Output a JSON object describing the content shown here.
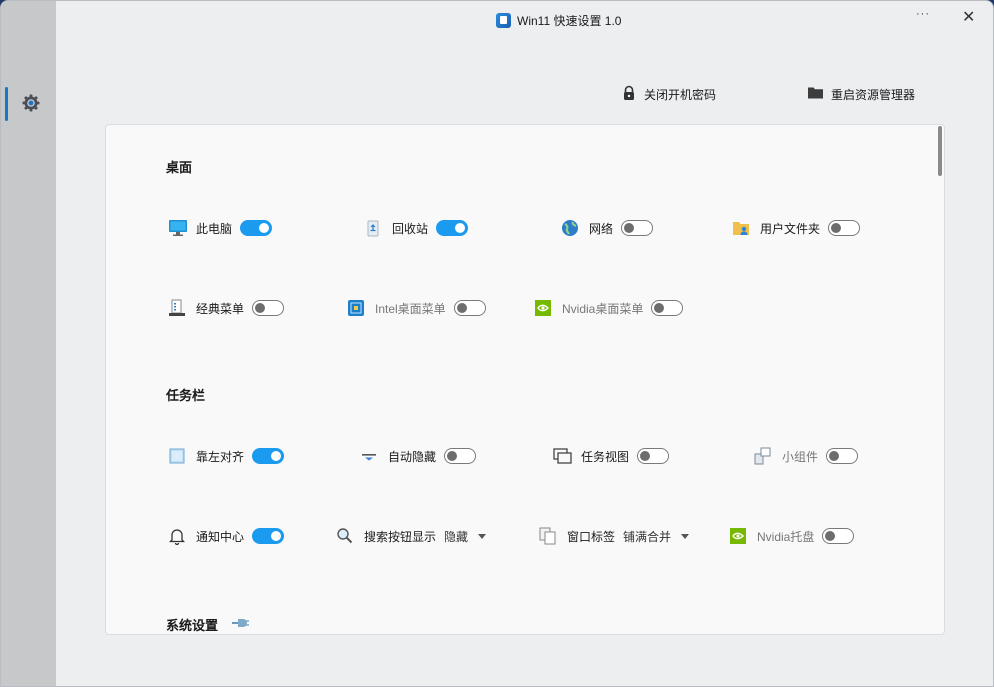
{
  "window": {
    "title": "Win11 快速设置 1.0",
    "more_label": "···",
    "close_label": "✕"
  },
  "sidebar": {
    "items": [
      {
        "icon": "gear-icon",
        "active": true
      }
    ]
  },
  "actions": {
    "lock_label": "关闭开机密码",
    "explorer_label": "重启资源管理器"
  },
  "sections": {
    "desktop": {
      "title": "桌面",
      "items": [
        {
          "label": "此电脑",
          "icon": "monitor-icon",
          "on": true
        },
        {
          "label": "回收站",
          "icon": "recycle-bin-icon",
          "on": true
        },
        {
          "label": "网络",
          "icon": "globe-icon",
          "on": false
        },
        {
          "label": "用户文件夹",
          "icon": "user-folder-icon",
          "on": false
        },
        {
          "label": "经典菜单",
          "icon": "classic-menu-icon",
          "on": false
        },
        {
          "label": "Intel桌面菜单",
          "icon": "intel-icon",
          "on": false,
          "disabled": true
        },
        {
          "label": "Nvidia桌面菜单",
          "icon": "nvidia-icon",
          "on": false,
          "disabled": true
        }
      ]
    },
    "taskbar": {
      "title": "任务栏",
      "items": [
        {
          "label": "靠左对齐",
          "icon": "align-left-icon",
          "on": true
        },
        {
          "label": "自动隐藏",
          "icon": "auto-hide-icon",
          "on": false
        },
        {
          "label": "任务视图",
          "icon": "task-view-icon",
          "on": false
        },
        {
          "label": "小组件",
          "icon": "widgets-icon",
          "on": false,
          "disabled": true
        },
        {
          "label": "通知中心",
          "icon": "bell-icon",
          "on": true
        },
        {
          "label": "搜索按钮显示",
          "icon": "search-icon",
          "dropdown": "隐藏"
        },
        {
          "label": "窗口标签",
          "icon": "window-tabs-icon",
          "dropdown": "铺满合并"
        },
        {
          "label": "Nvidia托盘",
          "icon": "nvidia-icon",
          "on": false,
          "disabled": true
        }
      ]
    },
    "system": {
      "title": "系统设置"
    }
  },
  "colors": {
    "accent": "#1a9bf0",
    "sidebar": "#c7c8ca",
    "window_bg": "#eceef0",
    "panel_bg": "#f9f9f9"
  }
}
